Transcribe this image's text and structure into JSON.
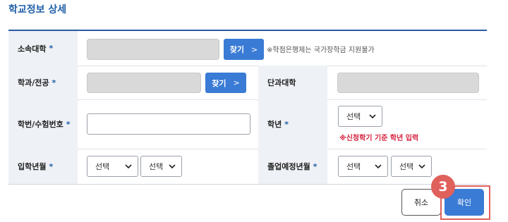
{
  "title": "학교정보 상세",
  "required_mark": "*",
  "rows": {
    "university": {
      "label": "소속대학",
      "find_label": "찾기",
      "note": "※학점은행제는 국가장학금 지원불가"
    },
    "department": {
      "label": "학과/전공",
      "find_label": "찾기",
      "college_label": "단과대학"
    },
    "student_id": {
      "label": "학번/수험번호",
      "value": "",
      "grade_label": "학년",
      "grade_select": "선택",
      "grade_note": "※신청학기 기준 학년 입력"
    },
    "admission": {
      "label": "입학년월",
      "year_select": "선택",
      "month_select": "선택",
      "graduation_label": "졸업예정년월",
      "grad_year_select": "선택",
      "grad_month_select": "선택"
    }
  },
  "buttons": {
    "cancel": "취소",
    "confirm": "확인"
  },
  "step_badge": "3",
  "colors": {
    "accent": "#3a7bd5",
    "title": "#1f5fa8",
    "required": "#1f5fa8",
    "warning": "#d4213d",
    "highlight": "#e0605c"
  }
}
